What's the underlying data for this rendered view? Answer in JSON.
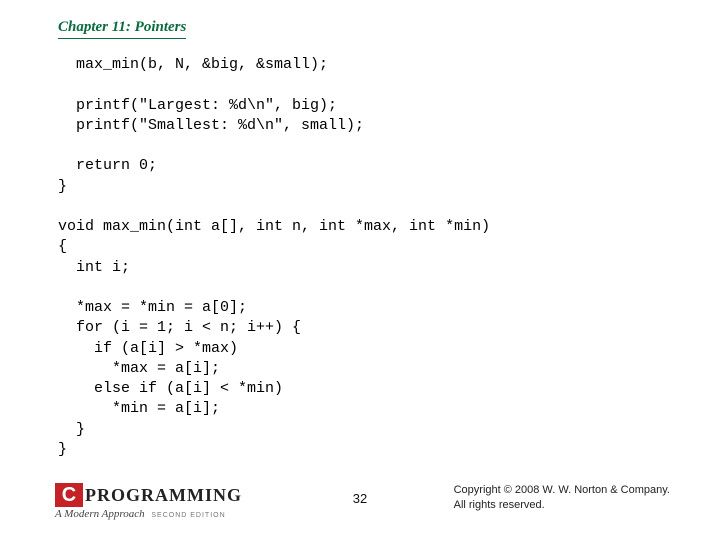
{
  "chapter_title": "Chapter 11: Pointers",
  "code_block": "  max_min(b, N, &big, &small);\n\n  printf(\"Largest: %d\\n\", big);\n  printf(\"Smallest: %d\\n\", small);\n\n  return 0;\n}\n\nvoid max_min(int a[], int n, int *max, int *min)\n{\n  int i;\n\n  *max = *min = a[0];\n  for (i = 1; i < n; i++) {\n    if (a[i] > *max)\n      *max = a[i];\n    else if (a[i] < *min)\n      *min = a[i];\n  }\n}",
  "logo": {
    "c_letter": "C",
    "word": "PROGRAMMING",
    "subtitle": "A Modern Approach",
    "edition": "SECOND EDITION"
  },
  "page_number": "32",
  "copyright_line1": "Copyright © 2008 W. W. Norton & Company.",
  "copyright_line2": "All rights reserved."
}
